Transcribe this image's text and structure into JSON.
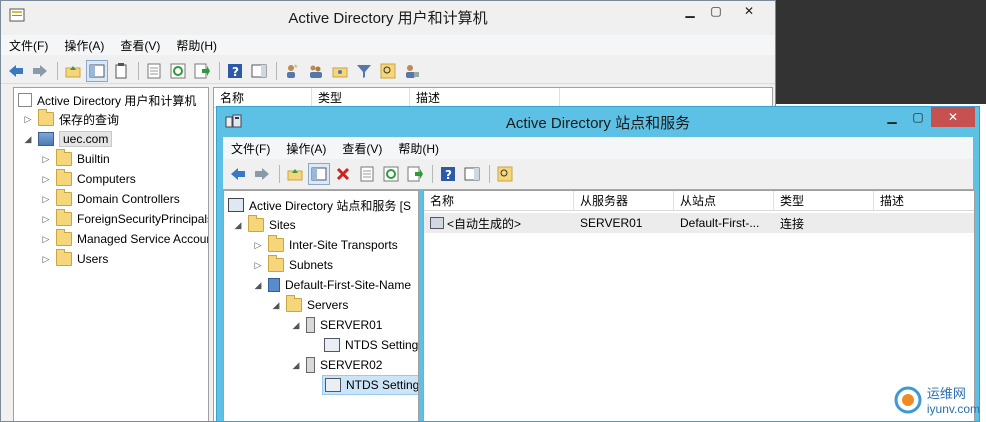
{
  "aduc": {
    "title": "Active Directory 用户和计算机",
    "menu": [
      "文件(F)",
      "操作(A)",
      "查看(V)",
      "帮助(H)"
    ],
    "tree": {
      "root": "Active Directory 用户和计算机",
      "saved_queries": "保存的查询",
      "domain": "uec.com",
      "children": [
        "Builtin",
        "Computers",
        "Domain Controllers",
        "ForeignSecurityPrincipals",
        "Managed Service Accounts",
        "Users"
      ]
    },
    "columns": [
      "名称",
      "类型",
      "描述"
    ]
  },
  "adss": {
    "title": "Active Directory 站点和服务",
    "menu": [
      "文件(F)",
      "操作(A)",
      "查看(V)",
      "帮助(H)"
    ],
    "tree": {
      "root": "Active Directory 站点和服务 [S",
      "sites": "Sites",
      "inter_site": "Inter-Site Transports",
      "subnets": "Subnets",
      "site": "Default-First-Site-Name",
      "servers": "Servers",
      "server1": "SERVER01",
      "ntds1": "NTDS Settings",
      "server2": "SERVER02",
      "ntds2": "NTDS Settings"
    },
    "columns": [
      "名称",
      "从服务器",
      "从站点",
      "类型",
      "描述"
    ],
    "rows": [
      {
        "name": "<自动生成的>",
        "from_server": "SERVER01",
        "from_site": "Default-First-...",
        "type": "连接",
        "desc": ""
      }
    ]
  },
  "watermark": {
    "cn": "运维网",
    "url": "iyunv.com"
  },
  "colors": {
    "adss_titlebar": "#5cc1e4",
    "close": "#c75050",
    "selection": "#cce4f7"
  }
}
